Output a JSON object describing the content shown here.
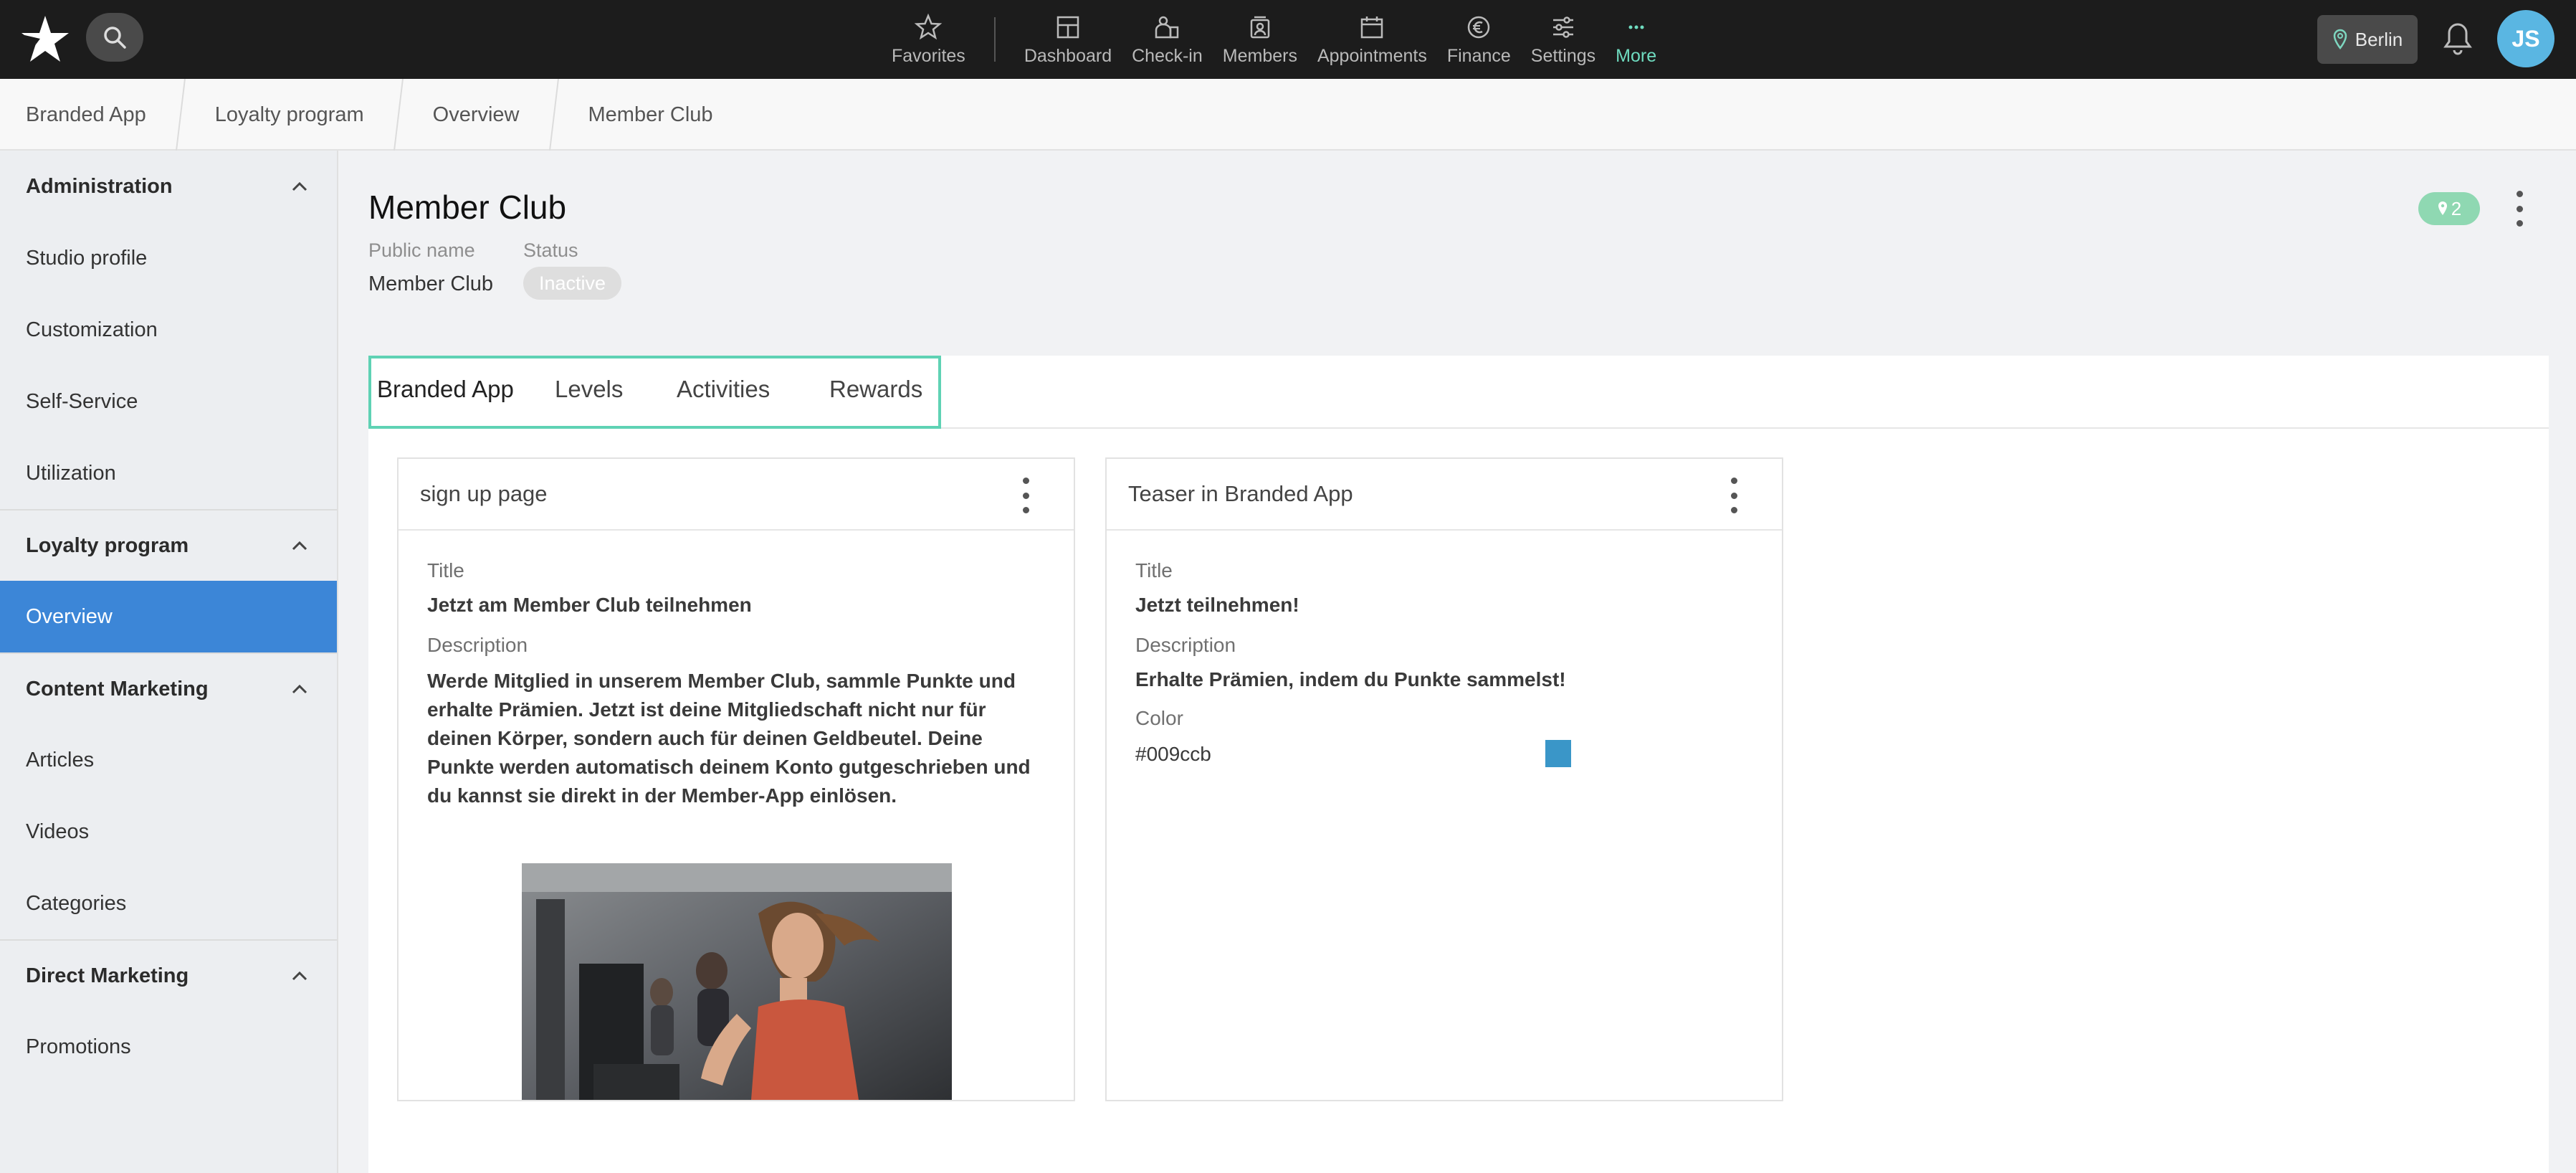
{
  "topbar": {
    "nav": [
      {
        "label": "Favorites",
        "icon": "star-icon"
      },
      {
        "label": "Dashboard",
        "icon": "dashboard-icon"
      },
      {
        "label": "Check-in",
        "icon": "check-in-icon"
      },
      {
        "label": "Members",
        "icon": "members-icon"
      },
      {
        "label": "Appointments",
        "icon": "calendar-icon"
      },
      {
        "label": "Finance",
        "icon": "euro-icon"
      },
      {
        "label": "Settings",
        "icon": "sliders-icon"
      },
      {
        "label": "More",
        "icon": "more-dots-icon"
      }
    ],
    "location": "Berlin",
    "avatar_initials": "JS"
  },
  "breadcrumb": [
    "Branded App",
    "Loyalty program",
    "Overview",
    "Member Club"
  ],
  "sidebar": {
    "groups": [
      {
        "label": "Administration",
        "items": [
          "Studio profile",
          "Customization",
          "Self-Service",
          "Utilization"
        ]
      },
      {
        "label": "Loyalty program",
        "items": [
          "Overview"
        ]
      },
      {
        "label": "Content Marketing",
        "items": [
          "Articles",
          "Videos",
          "Categories"
        ]
      },
      {
        "label": "Direct Marketing",
        "items": [
          "Promotions"
        ]
      }
    ],
    "active_item": "Overview"
  },
  "page": {
    "title": "Member Club",
    "public_name_label": "Public name",
    "public_name_value": "Member Club",
    "status_label": "Status",
    "status_value": "Inactive",
    "location_count": "2"
  },
  "tabs": [
    "Branded App",
    "Levels",
    "Activities",
    "Rewards"
  ],
  "cards": {
    "signup": {
      "title": "sign up page",
      "title_label": "Title",
      "title_value": "Jetzt am Member Club teilnehmen",
      "description_label": "Description",
      "description_value": "Werde Mitglied in unserem Member Club, sammle Punkte und erhalte Prämien. Jetzt ist deine Mitgliedschaft nicht nur für deinen Körper, sondern auch für deinen Geldbeutel. Deine Punkte werden automatisch deinem Konto gutgeschrieben und du kannst sie direkt in der Member-App einlösen."
    },
    "teaser": {
      "title": "Teaser in Branded App",
      "title_label": "Title",
      "title_value": "Jetzt teilnehmen!",
      "description_label": "Description",
      "description_value": "Erhalte Prämien, indem du Punkte sammelst!",
      "color_label": "Color",
      "color_value": "#009ccb"
    }
  },
  "colors": {
    "topbar": "#1c1c1c",
    "accent_teal": "#6fdcc0",
    "sidebar_active": "#3c86d7",
    "swatch": "#3a96c8"
  }
}
